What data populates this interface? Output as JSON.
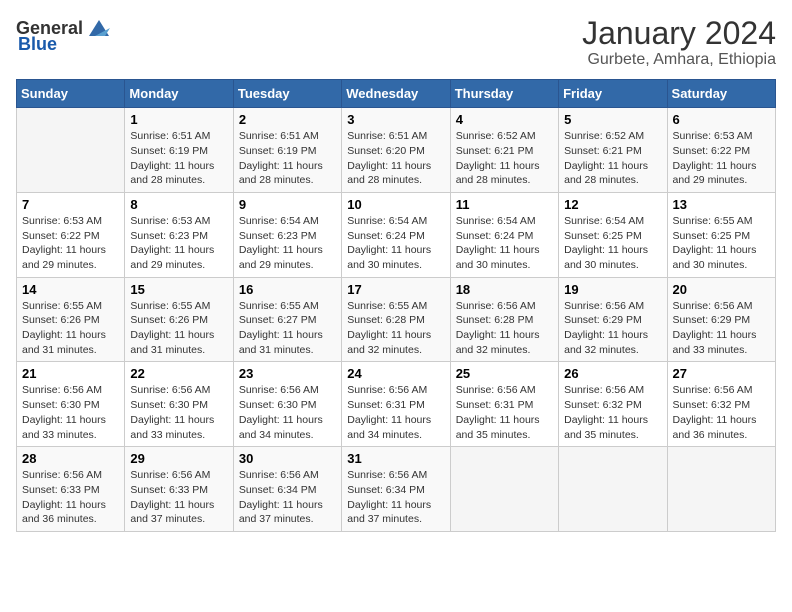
{
  "header": {
    "logo_general": "General",
    "logo_blue": "Blue",
    "title": "January 2024",
    "subtitle": "Gurbete, Amhara, Ethiopia"
  },
  "days_of_week": [
    "Sunday",
    "Monday",
    "Tuesday",
    "Wednesday",
    "Thursday",
    "Friday",
    "Saturday"
  ],
  "weeks": [
    [
      {
        "day": "",
        "sunrise": "",
        "sunset": "",
        "daylight": ""
      },
      {
        "day": "1",
        "sunrise": "Sunrise: 6:51 AM",
        "sunset": "Sunset: 6:19 PM",
        "daylight": "Daylight: 11 hours and 28 minutes."
      },
      {
        "day": "2",
        "sunrise": "Sunrise: 6:51 AM",
        "sunset": "Sunset: 6:19 PM",
        "daylight": "Daylight: 11 hours and 28 minutes."
      },
      {
        "day": "3",
        "sunrise": "Sunrise: 6:51 AM",
        "sunset": "Sunset: 6:20 PM",
        "daylight": "Daylight: 11 hours and 28 minutes."
      },
      {
        "day": "4",
        "sunrise": "Sunrise: 6:52 AM",
        "sunset": "Sunset: 6:21 PM",
        "daylight": "Daylight: 11 hours and 28 minutes."
      },
      {
        "day": "5",
        "sunrise": "Sunrise: 6:52 AM",
        "sunset": "Sunset: 6:21 PM",
        "daylight": "Daylight: 11 hours and 28 minutes."
      },
      {
        "day": "6",
        "sunrise": "Sunrise: 6:53 AM",
        "sunset": "Sunset: 6:22 PM",
        "daylight": "Daylight: 11 hours and 29 minutes."
      }
    ],
    [
      {
        "day": "7",
        "sunrise": "Sunrise: 6:53 AM",
        "sunset": "Sunset: 6:22 PM",
        "daylight": "Daylight: 11 hours and 29 minutes."
      },
      {
        "day": "8",
        "sunrise": "Sunrise: 6:53 AM",
        "sunset": "Sunset: 6:23 PM",
        "daylight": "Daylight: 11 hours and 29 minutes."
      },
      {
        "day": "9",
        "sunrise": "Sunrise: 6:54 AM",
        "sunset": "Sunset: 6:23 PM",
        "daylight": "Daylight: 11 hours and 29 minutes."
      },
      {
        "day": "10",
        "sunrise": "Sunrise: 6:54 AM",
        "sunset": "Sunset: 6:24 PM",
        "daylight": "Daylight: 11 hours and 30 minutes."
      },
      {
        "day": "11",
        "sunrise": "Sunrise: 6:54 AM",
        "sunset": "Sunset: 6:24 PM",
        "daylight": "Daylight: 11 hours and 30 minutes."
      },
      {
        "day": "12",
        "sunrise": "Sunrise: 6:54 AM",
        "sunset": "Sunset: 6:25 PM",
        "daylight": "Daylight: 11 hours and 30 minutes."
      },
      {
        "day": "13",
        "sunrise": "Sunrise: 6:55 AM",
        "sunset": "Sunset: 6:25 PM",
        "daylight": "Daylight: 11 hours and 30 minutes."
      }
    ],
    [
      {
        "day": "14",
        "sunrise": "Sunrise: 6:55 AM",
        "sunset": "Sunset: 6:26 PM",
        "daylight": "Daylight: 11 hours and 31 minutes."
      },
      {
        "day": "15",
        "sunrise": "Sunrise: 6:55 AM",
        "sunset": "Sunset: 6:26 PM",
        "daylight": "Daylight: 11 hours and 31 minutes."
      },
      {
        "day": "16",
        "sunrise": "Sunrise: 6:55 AM",
        "sunset": "Sunset: 6:27 PM",
        "daylight": "Daylight: 11 hours and 31 minutes."
      },
      {
        "day": "17",
        "sunrise": "Sunrise: 6:55 AM",
        "sunset": "Sunset: 6:28 PM",
        "daylight": "Daylight: 11 hours and 32 minutes."
      },
      {
        "day": "18",
        "sunrise": "Sunrise: 6:56 AM",
        "sunset": "Sunset: 6:28 PM",
        "daylight": "Daylight: 11 hours and 32 minutes."
      },
      {
        "day": "19",
        "sunrise": "Sunrise: 6:56 AM",
        "sunset": "Sunset: 6:29 PM",
        "daylight": "Daylight: 11 hours and 32 minutes."
      },
      {
        "day": "20",
        "sunrise": "Sunrise: 6:56 AM",
        "sunset": "Sunset: 6:29 PM",
        "daylight": "Daylight: 11 hours and 33 minutes."
      }
    ],
    [
      {
        "day": "21",
        "sunrise": "Sunrise: 6:56 AM",
        "sunset": "Sunset: 6:30 PM",
        "daylight": "Daylight: 11 hours and 33 minutes."
      },
      {
        "day": "22",
        "sunrise": "Sunrise: 6:56 AM",
        "sunset": "Sunset: 6:30 PM",
        "daylight": "Daylight: 11 hours and 33 minutes."
      },
      {
        "day": "23",
        "sunrise": "Sunrise: 6:56 AM",
        "sunset": "Sunset: 6:30 PM",
        "daylight": "Daylight: 11 hours and 34 minutes."
      },
      {
        "day": "24",
        "sunrise": "Sunrise: 6:56 AM",
        "sunset": "Sunset: 6:31 PM",
        "daylight": "Daylight: 11 hours and 34 minutes."
      },
      {
        "day": "25",
        "sunrise": "Sunrise: 6:56 AM",
        "sunset": "Sunset: 6:31 PM",
        "daylight": "Daylight: 11 hours and 35 minutes."
      },
      {
        "day": "26",
        "sunrise": "Sunrise: 6:56 AM",
        "sunset": "Sunset: 6:32 PM",
        "daylight": "Daylight: 11 hours and 35 minutes."
      },
      {
        "day": "27",
        "sunrise": "Sunrise: 6:56 AM",
        "sunset": "Sunset: 6:32 PM",
        "daylight": "Daylight: 11 hours and 36 minutes."
      }
    ],
    [
      {
        "day": "28",
        "sunrise": "Sunrise: 6:56 AM",
        "sunset": "Sunset: 6:33 PM",
        "daylight": "Daylight: 11 hours and 36 minutes."
      },
      {
        "day": "29",
        "sunrise": "Sunrise: 6:56 AM",
        "sunset": "Sunset: 6:33 PM",
        "daylight": "Daylight: 11 hours and 37 minutes."
      },
      {
        "day": "30",
        "sunrise": "Sunrise: 6:56 AM",
        "sunset": "Sunset: 6:34 PM",
        "daylight": "Daylight: 11 hours and 37 minutes."
      },
      {
        "day": "31",
        "sunrise": "Sunrise: 6:56 AM",
        "sunset": "Sunset: 6:34 PM",
        "daylight": "Daylight: 11 hours and 37 minutes."
      },
      {
        "day": "",
        "sunrise": "",
        "sunset": "",
        "daylight": ""
      },
      {
        "day": "",
        "sunrise": "",
        "sunset": "",
        "daylight": ""
      },
      {
        "day": "",
        "sunrise": "",
        "sunset": "",
        "daylight": ""
      }
    ]
  ]
}
